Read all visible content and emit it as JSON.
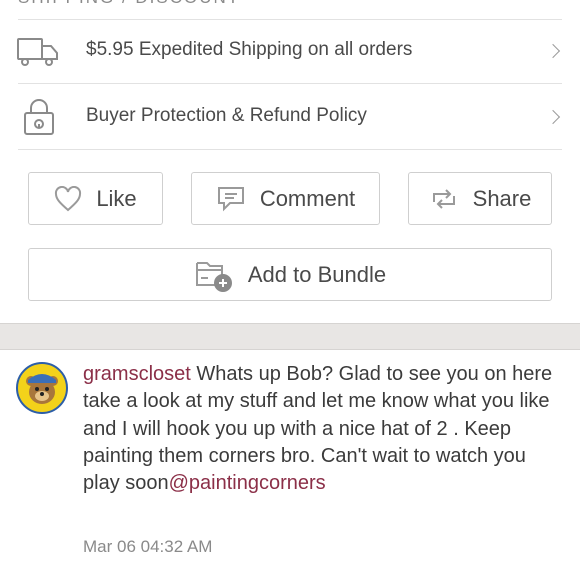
{
  "section_header": "SHIPPING / DISCOUNT",
  "rows": [
    {
      "icon": "truck-icon",
      "label": "$5.95 Expedited Shipping on all orders"
    },
    {
      "icon": "lock-icon",
      "label": "Buyer Protection & Refund Policy"
    }
  ],
  "actions": {
    "like_label": "Like",
    "comment_label": "Comment",
    "share_label": "Share",
    "bundle_label": "Add to Bundle"
  },
  "comment": {
    "username": "gramscloset",
    "text": " Whats up Bob? Glad to see you on here take a look at my stuff and let me know what you like and I will hook you up with a nice hat of 2 . Keep painting them corners bro. Can't wait to watch you play soon",
    "mention": "@paintingcorners",
    "timestamp": "Mar 06 04:32 AM"
  },
  "colors": {
    "accent": "#8b2f48",
    "border": "#cfcfcf",
    "band": "#e8e6e4"
  }
}
